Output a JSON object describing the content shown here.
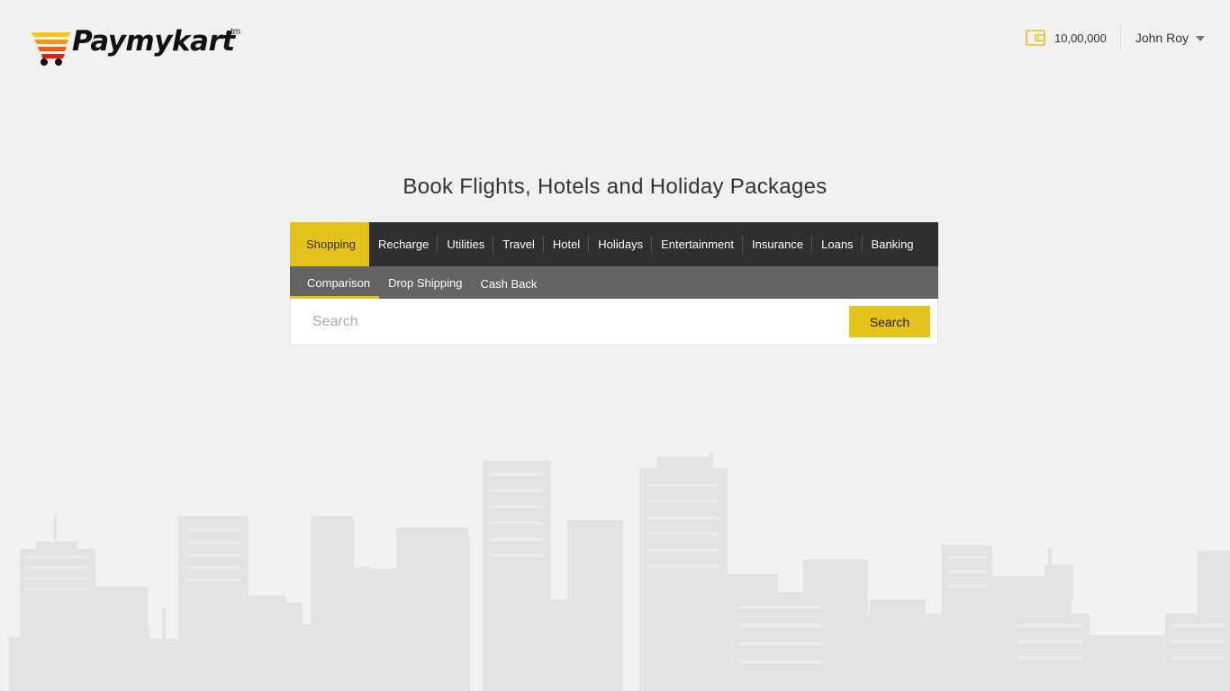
{
  "brand": {
    "name": "Paymykart",
    "trademark": "tm"
  },
  "account": {
    "wallet_icon": "wallet-icon",
    "wallet_balance": "10,00,000",
    "user_name": "John Roy"
  },
  "hero": {
    "title": "Book Flights, Hotels and Holiday Packages"
  },
  "main_tabs": [
    {
      "label": "Shopping",
      "active": true
    },
    {
      "label": "Recharge"
    },
    {
      "label": "Utilities"
    },
    {
      "label": "Travel"
    },
    {
      "label": "Hotel"
    },
    {
      "label": "Holidays"
    },
    {
      "label": "Entertainment"
    },
    {
      "label": "Insurance"
    },
    {
      "label": "Loans"
    },
    {
      "label": "Banking"
    }
  ],
  "sub_tabs": [
    {
      "label": "Comparison",
      "active": true
    },
    {
      "label": "Drop Shipping"
    },
    {
      "label": "Cash Back"
    }
  ],
  "search": {
    "placeholder": "Search",
    "value": "",
    "button_label": "Search"
  },
  "colors": {
    "accent": "#e6c21d",
    "tab_bar": "#2f2f2f",
    "sub_tab_bar": "#636363",
    "background": "#f1f1f1"
  }
}
